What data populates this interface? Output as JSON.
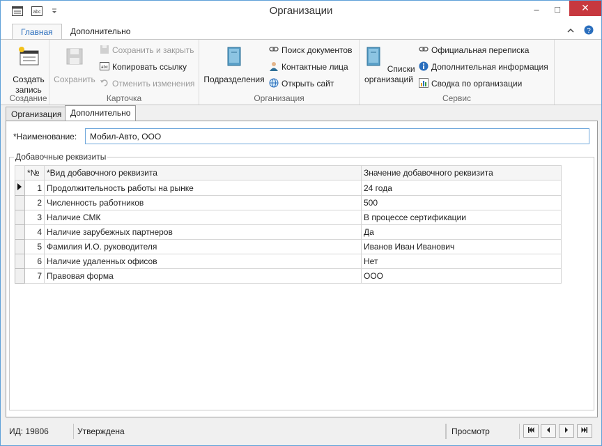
{
  "window": {
    "title": "Организации",
    "minimize": "–",
    "maximize": "□",
    "close": "✕"
  },
  "ribbon_tabs": [
    "Главная",
    "Дополнительно"
  ],
  "ribbon": {
    "create": {
      "label": "Создать запись",
      "group": "Создание"
    },
    "card": {
      "save": "Сохранить",
      "save_close": "Сохранить и закрыть",
      "copy_link": "Копировать ссылку",
      "cancel": "Отменить изменения",
      "group": "Карточка"
    },
    "org": {
      "divisions": "Подразделения",
      "search_docs": "Поиск документов",
      "contacts": "Контактные лица",
      "open_site": "Открыть сайт",
      "group": "Организация"
    },
    "service": {
      "lists": "Списки организаций",
      "correspondence": "Официальная переписка",
      "extra_info": "Дополнительная информация",
      "summary": "Сводка по организации",
      "group": "Сервис"
    }
  },
  "doc_tabs": [
    "Организация",
    "Дополнительно"
  ],
  "form": {
    "name_label": "*Наименование:",
    "name_value": "Мобил-Авто, ООО",
    "fieldset": "Добавочные реквизиты"
  },
  "table": {
    "headers": [
      "*№",
      "*Вид добавочного реквизита",
      "Значение добавочного реквизита"
    ],
    "rows": [
      {
        "n": "1",
        "kind": "Продолжительность работы на рынке",
        "value": "24 года"
      },
      {
        "n": "2",
        "kind": "Численность работников",
        "value": "500"
      },
      {
        "n": "3",
        "kind": "Наличие СМК",
        "value": "В процессе сертификации"
      },
      {
        "n": "4",
        "kind": "Наличие зарубежных партнеров",
        "value": "Да"
      },
      {
        "n": "5",
        "kind": "Фамилия И.О. руководителя",
        "value": "Иванов Иван Иванович"
      },
      {
        "n": "6",
        "kind": "Наличие удаленных офисов",
        "value": "Нет"
      },
      {
        "n": "7",
        "kind": "Правовая форма",
        "value": "ООО"
      }
    ]
  },
  "status": {
    "id": "ИД: 19806",
    "state": "Утверждена",
    "mode": "Просмотр"
  },
  "colors": {
    "accent": "#2a6ebd",
    "close": "#c7383f",
    "border": "#5ea0d8"
  }
}
